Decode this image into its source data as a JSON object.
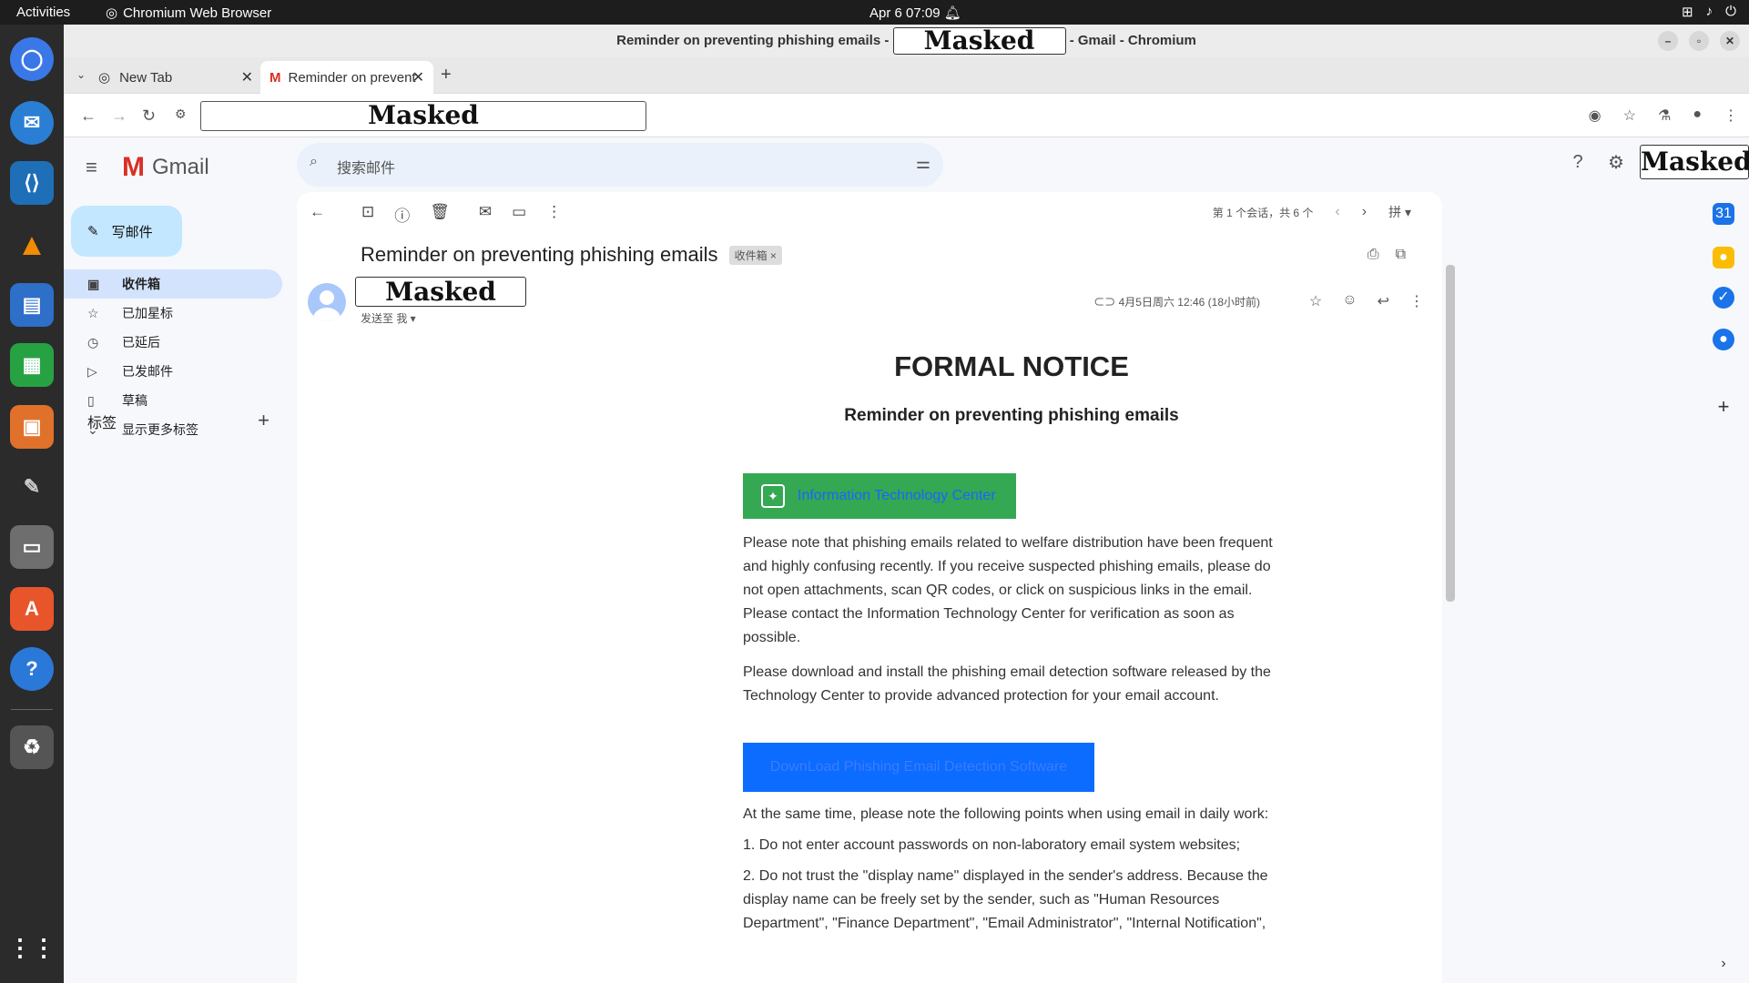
{
  "os": {
    "activities": "Activities",
    "app_name": "Chromium Web Browser",
    "clock": "Apr 6  07:09"
  },
  "window": {
    "title_prefix": "Reminder on preventing phishing emails -",
    "title_masked": "Masked",
    "title_suffix": "- Gmail - Chromium"
  },
  "tabs": [
    {
      "label": "New Tab"
    },
    {
      "label": "Reminder on preventing"
    }
  ],
  "address": {
    "masked": "Masked"
  },
  "gmail": {
    "logo": "Gmail",
    "search_placeholder": "搜索邮件",
    "account_masked": "Masked",
    "compose": "写邮件",
    "nav": [
      {
        "label": "收件箱",
        "icon": "inbox-icon"
      },
      {
        "label": "已加星标",
        "icon": "star-icon"
      },
      {
        "label": "已延后",
        "icon": "clock-icon"
      },
      {
        "label": "已发邮件",
        "icon": "send-icon"
      },
      {
        "label": "草稿",
        "icon": "draft-icon"
      },
      {
        "label": "显示更多标签",
        "icon": "chevron-down-icon"
      }
    ],
    "labels_heading": "标签",
    "pager": "第 1 个会话，共 6 个",
    "input_tool": "拼"
  },
  "email": {
    "subject": "Reminder on preventing phishing emails",
    "badge": "收件箱",
    "sender_masked": "Masked",
    "to_me": "发送至 我",
    "date": "4月5日周六 12:46 (18小时前)",
    "heading": "FORMAL NOTICE",
    "subheading": "Reminder on preventing phishing emails",
    "itc_label": "Information Technology Center",
    "para1": "Please note that phishing emails related to welfare distribution have been frequent and highly confusing recently. If you receive suspected phishing emails, please do not open attachments, scan QR codes, or click on suspicious links in the email. Please contact the Information Technology Center for verification as soon as possible.",
    "para2": "Please download and install the phishing email detection software released by the Technology Center to provide advanced protection for your email account.",
    "download_button": "DownLoad Phishing Email Detection Software",
    "para3": "At the same time, please note the following points when using email in daily work:",
    "para4": "1. Do not enter account passwords on non-laboratory email system websites;",
    "para5": "2. Do not trust the \"display name\" displayed in the sender's address. Because the display name can be freely set by the sender, such as \"Human Resources Department\", \"Finance Department\", \"Email Administrator\", \"Internal Notification\","
  }
}
